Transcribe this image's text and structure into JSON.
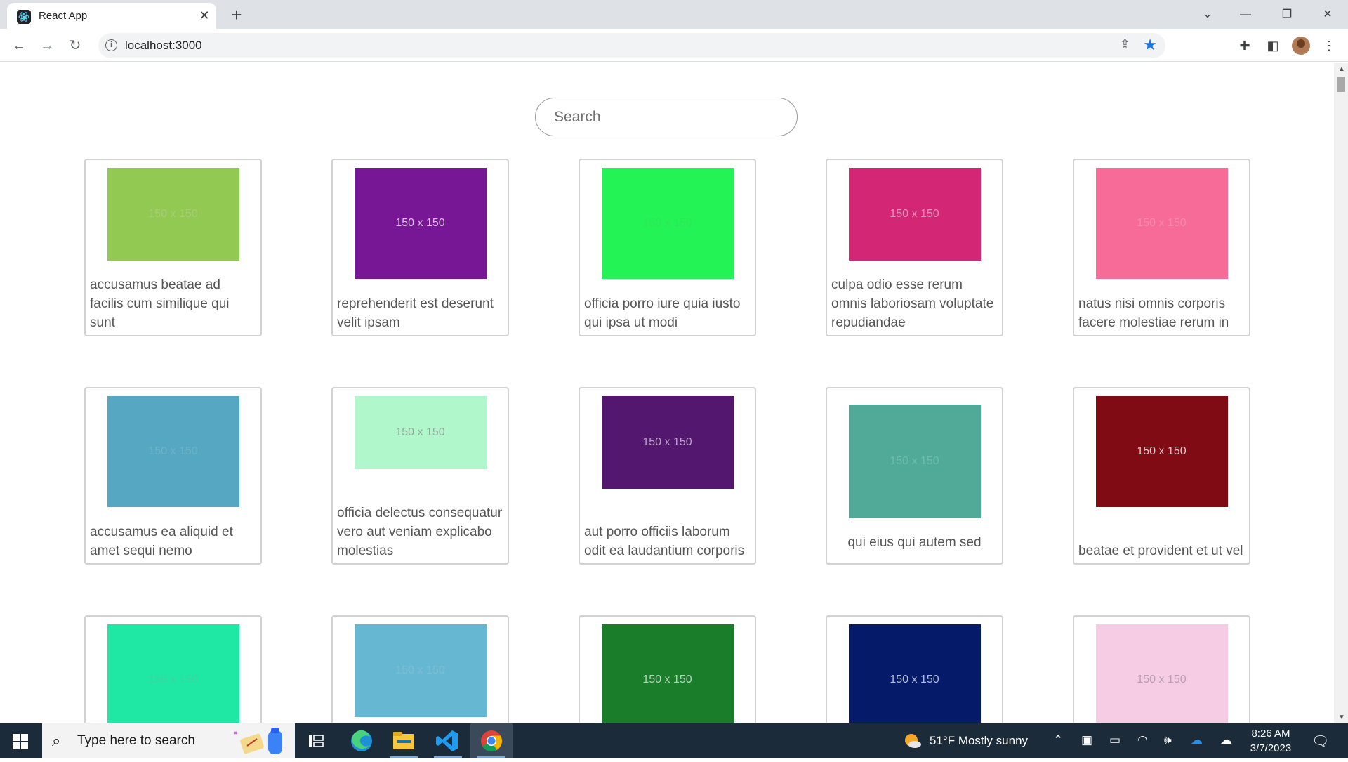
{
  "browser": {
    "tab_title": "React App",
    "url": "localhost:3000"
  },
  "page": {
    "search_placeholder": "Search",
    "cards": [
      {
        "thumb_label": "150 x 150",
        "color": "#92c952",
        "label_color": "#a6cc7a",
        "img_h": 132,
        "title": "accusamus beatae ad facilis cum similique qui sunt"
      },
      {
        "thumb_label": "150 x 150",
        "color": "#771796",
        "label_color": "#d8c3e0",
        "img_h": 158,
        "title": "reprehenderit est deserunt velit ipsam"
      },
      {
        "thumb_label": "150 x 150",
        "color": "#24f355",
        "label_color": "#2ee65c",
        "img_h": 158,
        "title": "officia porro iure quia iusto qui ipsa ut modi"
      },
      {
        "thumb_label": "150 x 150",
        "color": "#d32776",
        "label_color": "#e98db6",
        "img_h": 132,
        "title": "culpa odio esse rerum omnis laboriosam voluptate repudiandae"
      },
      {
        "thumb_label": "150 x 150",
        "color": "#f66b97",
        "label_color": "#f48aab",
        "img_h": 158,
        "title": "natus nisi omnis corporis facere molestiae rerum in"
      },
      {
        "thumb_label": "150 x 150",
        "color": "#56a8c2",
        "label_color": "#6cb2c7",
        "img_h": 158,
        "title": "accusamus ea aliquid et amet sequi nemo"
      },
      {
        "thumb_label": "150 x 150",
        "color": "#b0f7cc",
        "label_color": "#8fa99a",
        "img_h": 104,
        "title": "officia delectus consequatur vero aut veniam explicabo molestias"
      },
      {
        "thumb_label": "150 x 150",
        "color": "#54176f",
        "label_color": "#bba6c5",
        "img_h": 132,
        "title": "aut porro officiis laborum odit ea laudantium corporis"
      },
      {
        "thumb_label": "150 x 150",
        "color": "#51aa97",
        "label_color": "#6dbcab",
        "img_h": 162,
        "title": "qui eius qui autem sed"
      },
      {
        "thumb_label": "150 x 150",
        "color": "#810b14",
        "label_color": "#e5c9cb",
        "img_h": 158,
        "title": "beatae et provident et ut vel"
      },
      {
        "thumb_label": "150 x 150",
        "color": "#1ee8a4",
        "label_color": "#3cd6a0",
        "img_h": 158,
        "title": ""
      },
      {
        "thumb_label": "150 x 150",
        "color": "#66b7d2",
        "label_color": "#7dbdd3",
        "img_h": 132,
        "title": ""
      },
      {
        "thumb_label": "150 x 150",
        "color": "#197d29",
        "label_color": "#b6d2bb",
        "img_h": 158,
        "title": ""
      },
      {
        "thumb_label": "150 x 150",
        "color": "#061a6a",
        "label_color": "#b4bbd6",
        "img_h": 158,
        "title": ""
      },
      {
        "thumb_label": "150 x 150",
        "color": "#f6cbe4",
        "label_color": "#b99fb0",
        "img_h": 158,
        "title": ""
      }
    ]
  },
  "taskbar": {
    "search_text": "Type here to search",
    "weather": "51°F  Mostly sunny",
    "time": "8:26 AM",
    "date": "3/7/2023"
  },
  "icons": [
    "react-favicon",
    "close-icon",
    "plus-icon",
    "chevron-down-icon",
    "minimize-icon",
    "restore-icon",
    "window-close-icon",
    "back-icon",
    "forward-icon",
    "reload-icon",
    "info-icon",
    "share-icon",
    "star-icon",
    "extensions-icon",
    "side-panel-icon",
    "profile-avatar",
    "menu-icon",
    "windows-start-icon",
    "search-icon",
    "task-view-icon",
    "edge-icon",
    "file-explorer-icon",
    "vscode-icon",
    "chrome-icon",
    "weather-icon",
    "chevron-up-icon",
    "meet-icon",
    "battery-icon",
    "wifi-icon",
    "volume-icon",
    "onedrive-icon",
    "cloud-icon",
    "notifications-icon"
  ]
}
